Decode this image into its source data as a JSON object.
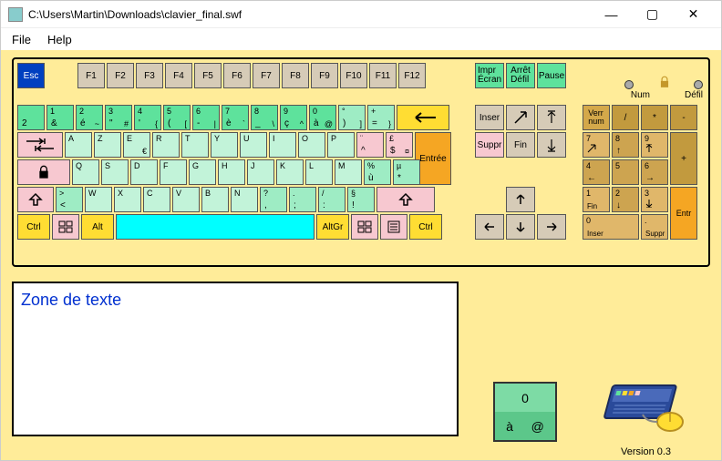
{
  "window": {
    "title": "C:\\Users\\Martin\\Downloads\\clavier_final.swf"
  },
  "menu": {
    "file": "File",
    "help": "Help"
  },
  "keys": {
    "esc": "Esc",
    "f": [
      "F1",
      "F2",
      "F3",
      "F4",
      "F5",
      "F6",
      "F7",
      "F8",
      "F9",
      "F10",
      "F11",
      "F12"
    ],
    "sys": {
      "impr": "Impr\nÉcran",
      "arret": "Arrêt\nDéfil",
      "pause": "Pause"
    },
    "leds": {
      "num": "Num",
      "defil": "Défil"
    },
    "row1": [
      {
        "top": "",
        "bot": "2"
      },
      {
        "top": "1",
        "bot": "&"
      },
      {
        "top": "2",
        "bot": "é",
        "br": "~"
      },
      {
        "top": "3",
        "bot": "\"",
        "br": "#"
      },
      {
        "top": "4",
        "bot": "'",
        "br": "{"
      },
      {
        "top": "5",
        "bot": "(",
        "br": "["
      },
      {
        "top": "6",
        "bot": "-",
        "br": "|"
      },
      {
        "top": "7",
        "bot": "è",
        "br": "`"
      },
      {
        "top": "8",
        "bot": "_",
        "br": "\\"
      },
      {
        "top": "9",
        "bot": "ç",
        "br": "^"
      },
      {
        "top": "0",
        "bot": "à",
        "br": "@"
      },
      {
        "top": "°",
        "bot": ")",
        "br": "]"
      },
      {
        "top": "+",
        "bot": "=",
        "br": "}"
      }
    ],
    "row2": [
      "A",
      "Z",
      "E",
      "R",
      "T",
      "Y",
      "U",
      "I",
      "O",
      "P"
    ],
    "row2_end": [
      {
        "top": "¨",
        "bot": "^"
      },
      {
        "top": "£",
        "bot": "$",
        "br": "¤"
      }
    ],
    "row2_extra_e": "€",
    "enter": "Entrée",
    "row3": [
      "Q",
      "S",
      "D",
      "F",
      "G",
      "H",
      "J",
      "K",
      "L",
      "M"
    ],
    "row3_end": [
      {
        "top": "%",
        "bot": "ù"
      },
      {
        "top": "µ",
        "bot": "*"
      }
    ],
    "row4_first": {
      "top": ">",
      "bot": "<"
    },
    "row4": [
      "W",
      "X",
      "C",
      "V",
      "B",
      "N"
    ],
    "row4_end": [
      {
        "top": "?",
        "bot": ",",
        "br": ""
      },
      {
        "top": ".",
        "bot": ";",
        "br": ""
      },
      {
        "top": "/",
        "bot": ":",
        "br": ""
      },
      {
        "top": "§",
        "bot": "!",
        "br": ""
      }
    ],
    "row5": {
      "ctrl": "Ctrl",
      "alt": "Alt",
      "altgr": "AltGr"
    },
    "nav": {
      "inser": "Inser",
      "suppr": "Suppr",
      "fin": "Fin"
    },
    "numpad": {
      "verr": "Verr\nnum",
      "div": "/",
      "mul": "*",
      "sub": "-",
      "7": "7",
      "8": "8",
      "9": "9",
      "plus": "+",
      "4": "4",
      "5": "5",
      "6": "6",
      "1": "1",
      "2": "2",
      "3": "3",
      "entr": "Entr",
      "1s": "Fin",
      "0": "0",
      "0s": "Inser",
      "dot": ".",
      "dots": "Suppr"
    }
  },
  "textzone": "Zone de texte",
  "preview": {
    "top": "0",
    "bot1": "à",
    "bot2": "@"
  },
  "version": "Version 0.3"
}
